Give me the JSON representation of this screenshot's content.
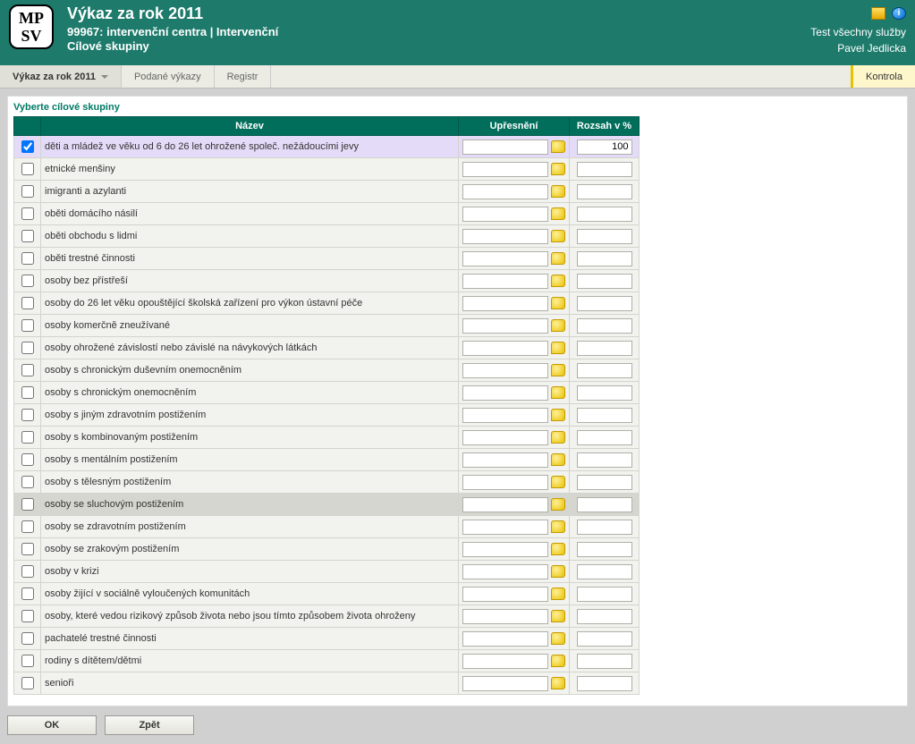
{
  "header": {
    "title": "Výkaz za rok 2011",
    "subtitle": "99967: intervenční centra | Intervenční",
    "section": "Cílové skupiny",
    "client": "Test všechny služby",
    "user": "Pavel Jedlicka"
  },
  "tabs": {
    "vykaz": "Výkaz za rok 2011",
    "podane": "Podané výkazy",
    "registr": "Registr",
    "kontrola": "Kontrola"
  },
  "group_label": "Vyberte cílové skupiny",
  "columns": {
    "nazev": "Název",
    "upresneni": "Upřesnění",
    "rozsah": "Rozsah v %"
  },
  "rows": [
    {
      "checked": true,
      "name": "děti a mládež ve věku od 6 do 26 let ohrožené společ. nežádoucími jevy",
      "upresneni": "",
      "rozsah": "100",
      "selected": true
    },
    {
      "checked": false,
      "name": "etnické menšiny",
      "upresneni": "",
      "rozsah": ""
    },
    {
      "checked": false,
      "name": "imigranti a azylanti",
      "upresneni": "",
      "rozsah": ""
    },
    {
      "checked": false,
      "name": "oběti domácího násilí",
      "upresneni": "",
      "rozsah": ""
    },
    {
      "checked": false,
      "name": "oběti obchodu s lidmi",
      "upresneni": "",
      "rozsah": ""
    },
    {
      "checked": false,
      "name": "oběti trestné činnosti",
      "upresneni": "",
      "rozsah": ""
    },
    {
      "checked": false,
      "name": "osoby bez přístřeší",
      "upresneni": "",
      "rozsah": ""
    },
    {
      "checked": false,
      "name": "osoby do 26 let věku opouštějící školská zařízení pro výkon ústavní péče",
      "upresneni": "",
      "rozsah": ""
    },
    {
      "checked": false,
      "name": "osoby komerčně zneužívané",
      "upresneni": "",
      "rozsah": ""
    },
    {
      "checked": false,
      "name": "osoby ohrožené závislostí nebo závislé na návykových látkách",
      "upresneni": "",
      "rozsah": ""
    },
    {
      "checked": false,
      "name": "osoby s chronickým duševním onemocněním",
      "upresneni": "",
      "rozsah": ""
    },
    {
      "checked": false,
      "name": "osoby s chronickým onemocněním",
      "upresneni": "",
      "rozsah": ""
    },
    {
      "checked": false,
      "name": "osoby s jiným zdravotním postižením",
      "upresneni": "",
      "rozsah": ""
    },
    {
      "checked": false,
      "name": "osoby s kombinovaným postižením",
      "upresneni": "",
      "rozsah": ""
    },
    {
      "checked": false,
      "name": "osoby s mentálním postižením",
      "upresneni": "",
      "rozsah": ""
    },
    {
      "checked": false,
      "name": "osoby s tělesným postižením",
      "upresneni": "",
      "rozsah": ""
    },
    {
      "checked": false,
      "name": "osoby se sluchovým postižením",
      "upresneni": "",
      "rozsah": "",
      "hover": true
    },
    {
      "checked": false,
      "name": "osoby se zdravotním postižením",
      "upresneni": "",
      "rozsah": ""
    },
    {
      "checked": false,
      "name": "osoby se zrakovým postižením",
      "upresneni": "",
      "rozsah": ""
    },
    {
      "checked": false,
      "name": "osoby v krizi",
      "upresneni": "",
      "rozsah": ""
    },
    {
      "checked": false,
      "name": "osoby žijící v sociálně vyloučených komunitách",
      "upresneni": "",
      "rozsah": ""
    },
    {
      "checked": false,
      "name": "osoby, které vedou rizikový způsob života nebo jsou tímto způsobem života ohroženy",
      "upresneni": "",
      "rozsah": ""
    },
    {
      "checked": false,
      "name": "pachatelé trestné činnosti",
      "upresneni": "",
      "rozsah": ""
    },
    {
      "checked": false,
      "name": "rodiny s dítětem/dětmi",
      "upresneni": "",
      "rozsah": ""
    },
    {
      "checked": false,
      "name": "senioři",
      "upresneni": "",
      "rozsah": ""
    }
  ],
  "buttons": {
    "ok": "OK",
    "back": "Zpět"
  },
  "logo_text": "MP\nSV"
}
